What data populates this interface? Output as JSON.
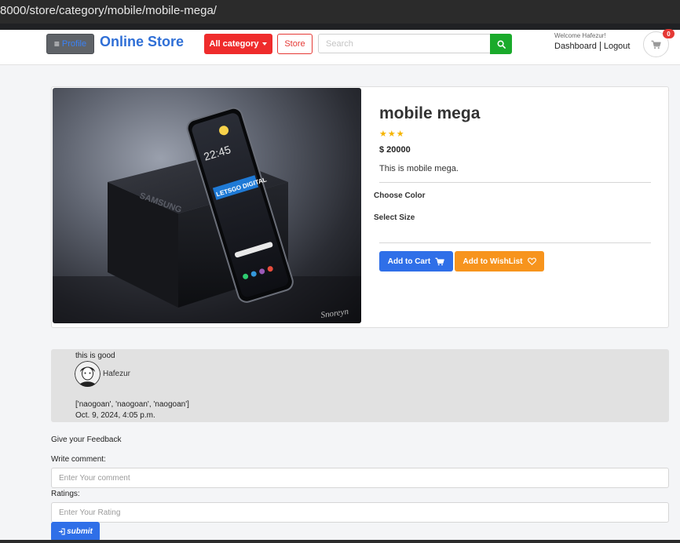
{
  "browser": {
    "url": "8000/store/category/mobile/mobile-mega/"
  },
  "header": {
    "profile_label": "Profile",
    "brand": "Online Store",
    "category_label": "All category",
    "store_label": "Store",
    "search_placeholder": "Search",
    "welcome": "Welcome Hafezur!",
    "dashboard_label": "Dashboard",
    "logout_label": "Logout",
    "cart_count": "0",
    "icons": [
      "bars-icon",
      "caret-down-icon",
      "search-icon",
      "shopping-cart-icon"
    ]
  },
  "product": {
    "title": "mobile mega",
    "stars": "★★★",
    "rating": 3,
    "price": "$ 20000",
    "description": "This is mobile mega.",
    "choose_color_label": "Choose Color",
    "select_size_label": "Select Size",
    "add_to_cart_label": "Add to Cart",
    "add_to_wishlist_label": "Add to WishList",
    "image_texts": {
      "time": "22:45",
      "brand_text": "LETSGO DIGITAL",
      "box_text": "SAMSUNG",
      "signature": "Snoreyn"
    }
  },
  "review": {
    "text": "this is good",
    "user": "Hafezur",
    "list": "['naogoan', 'naogoan', 'naogoan']",
    "date": "Oct. 9, 2024, 4:05 p.m."
  },
  "feedback": {
    "title": "Give your Feedback",
    "comment_label": "Write comment:",
    "comment_placeholder": "Enter Your comment",
    "ratings_label": "Ratings:",
    "rating_placeholder": "Enter Your Rating",
    "submit_label": "submit"
  },
  "colors": {
    "brand": "#2f6fd6",
    "danger": "#ef2c2c",
    "success": "#1aaa2b",
    "primary": "#2f6fe8",
    "warning": "#f7941d",
    "star": "#f5b400"
  }
}
